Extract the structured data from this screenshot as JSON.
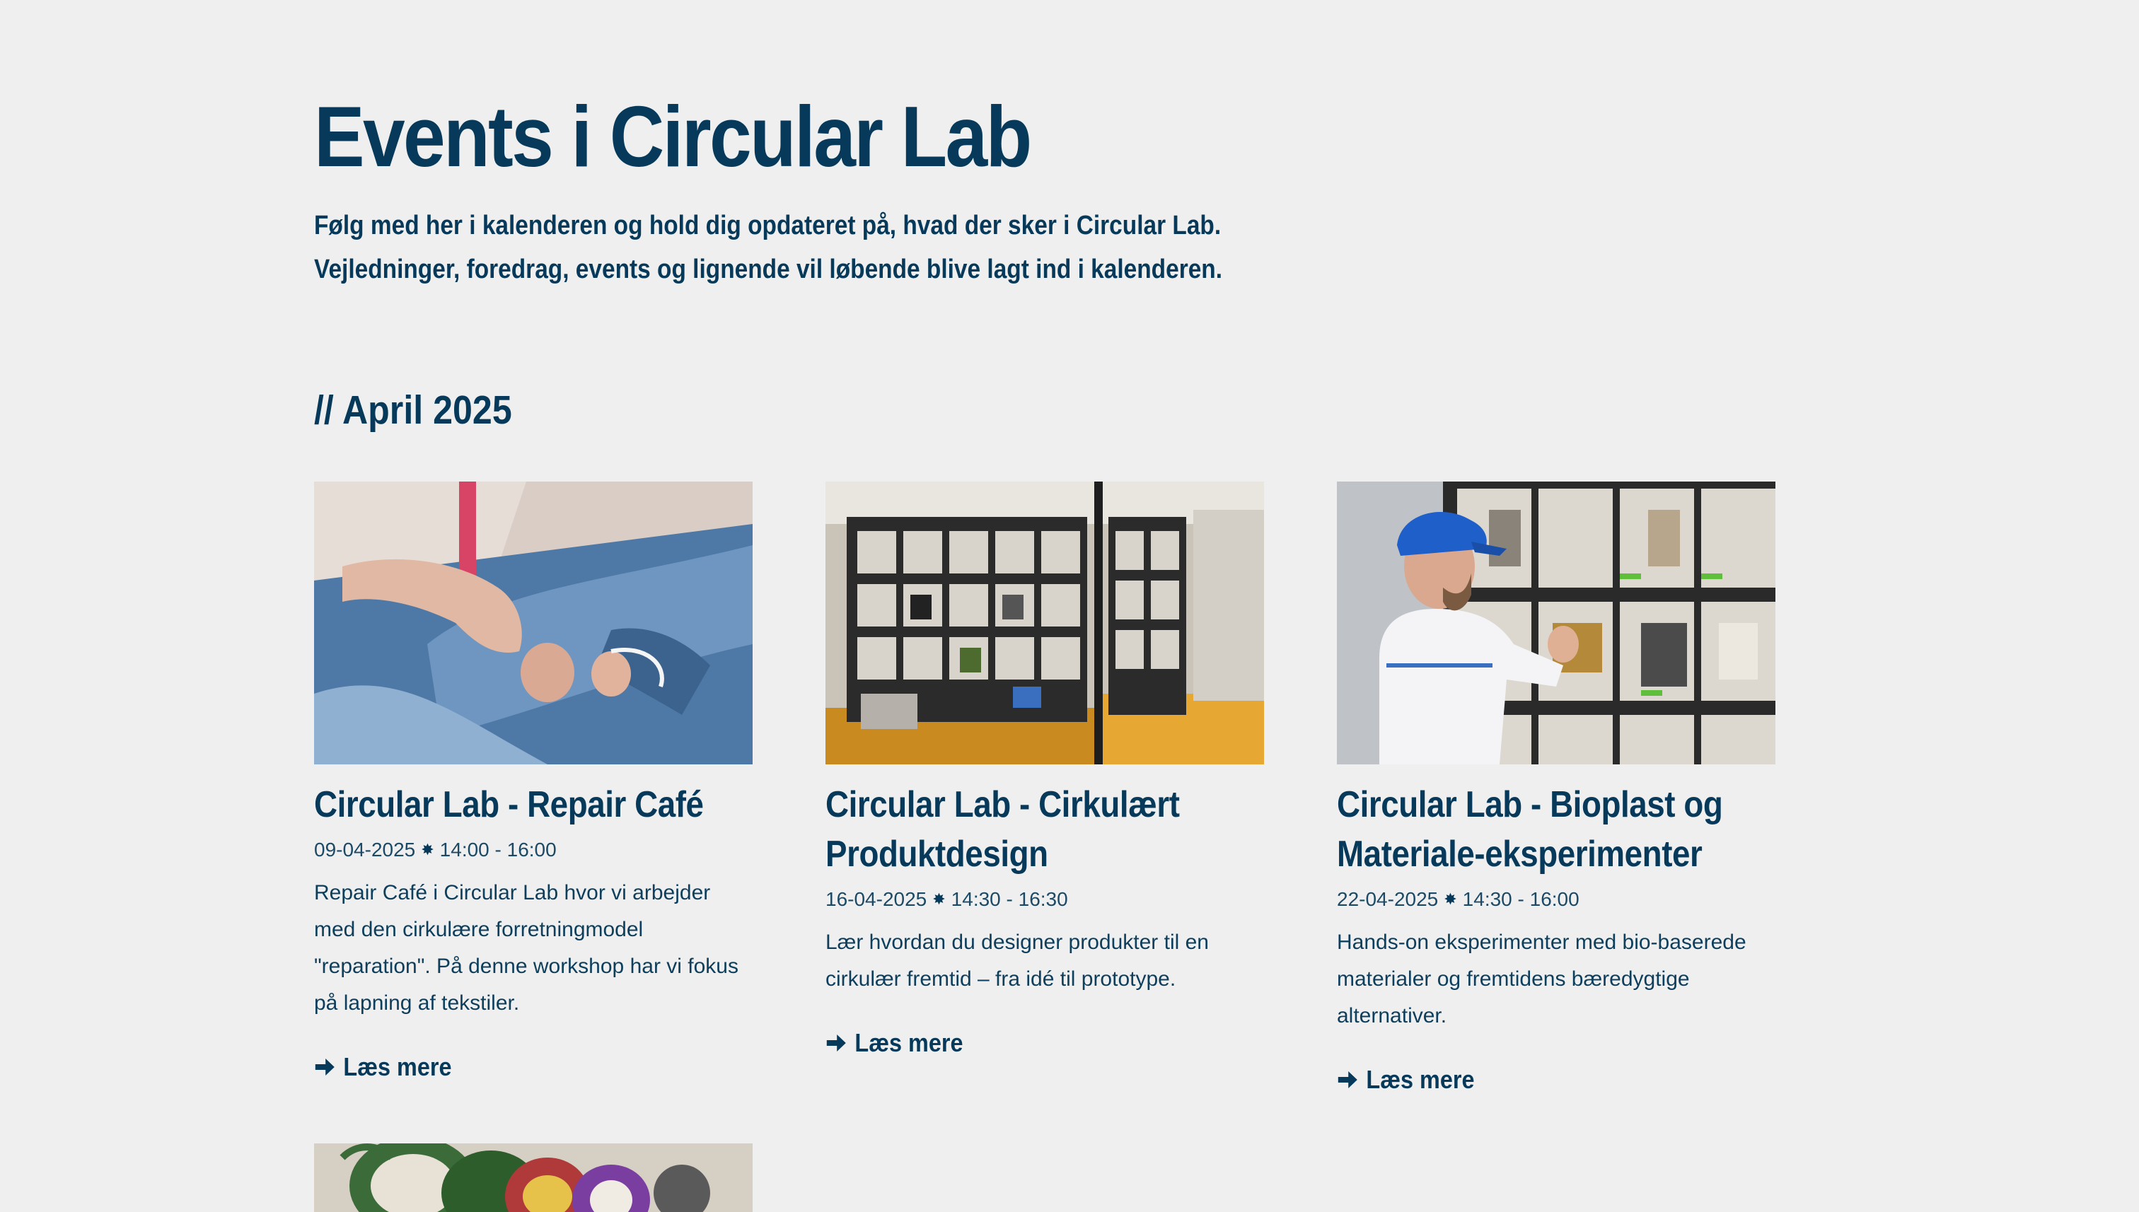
{
  "header": {
    "title": "Events i Circular Lab",
    "intro": "Følg med her i kalenderen og hold dig opdateret på, hvad der sker i Circular Lab. Vejledninger, foredrag, events og lignende vil løbende blive lagt ind i kalenderen."
  },
  "month": {
    "heading": "// April 2025"
  },
  "events": [
    {
      "title": "Circular Lab - Repair Café",
      "date": "09-04-2025",
      "separator": "✸",
      "time": "14:00 - 16:00",
      "description": "Repair Café i Circular Lab hvor vi arbejder med den cirkulære forretningmodel \"reparation\". På denne workshop har vi fokus på lapning af tekstiler.",
      "read_more": "Læs mere",
      "image_icon": "jeans-repair-photo"
    },
    {
      "title": "Circular Lab - Cirkulært Produktdesign",
      "date": "16-04-2025",
      "separator": "✸",
      "time": "14:30 - 16:30",
      "description": "Lær hvordan du designer produkter til en cirkulær fremtid – fra idé til prototype.",
      "read_more": "Læs mere",
      "image_icon": "material-library-shelf-photo"
    },
    {
      "title": "Circular Lab - Bioplast og Materiale-eksperimenter",
      "date": "22-04-2025",
      "separator": "✸",
      "time": "14:30 - 16:00",
      "description": "Hands-on eksperimenter med bio-baserede materialer og fremtidens bæredygtige alternativer.",
      "read_more": "Læs mere",
      "image_icon": "man-at-material-wall-photo"
    }
  ],
  "colors": {
    "background": "#efefef",
    "primary_text": "#073a5a"
  }
}
